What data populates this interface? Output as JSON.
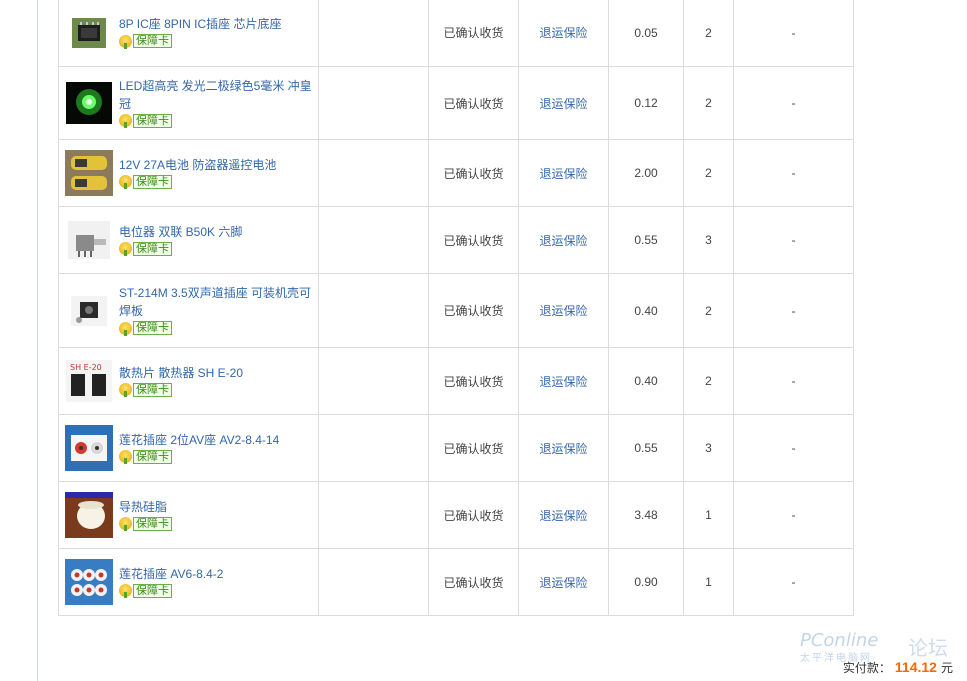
{
  "items": [
    {
      "title": "8P IC座 8PIN IC插座 芯片底座",
      "badge": "保障卡",
      "status": "已确认收货",
      "insurance": "退运保险",
      "price": "0.05",
      "qty": "2",
      "extra": "-",
      "thumb": "ic-socket-thumbnail"
    },
    {
      "title": "LED超高亮 发光二极绿色5毫米 冲皇冠",
      "badge": "保障卡",
      "status": "已确认收货",
      "insurance": "退运保险",
      "price": "0.12",
      "qty": "2",
      "extra": "-",
      "thumb": "green-led-thumbnail"
    },
    {
      "title": "12V 27A电池 防盗器遥控电池",
      "badge": "保障卡",
      "status": "已确认收货",
      "insurance": "退运保险",
      "price": "2.00",
      "qty": "2",
      "extra": "-",
      "thumb": "battery-thumbnail"
    },
    {
      "title": "电位器 双联 B50K 六脚",
      "badge": "保障卡",
      "status": "已确认收货",
      "insurance": "退运保险",
      "price": "0.55",
      "qty": "3",
      "extra": "-",
      "thumb": "potentiometer-thumbnail"
    },
    {
      "title": "ST-214M 3.5双声道插座 可装机壳可焊板",
      "badge": "保障卡",
      "status": "已确认收货",
      "insurance": "退运保险",
      "price": "0.40",
      "qty": "2",
      "extra": "-",
      "thumb": "audio-jack-thumbnail"
    },
    {
      "title": "散热片 散热器 SH E-20",
      "badge": "保障卡",
      "status": "已确认收货",
      "insurance": "退运保险",
      "price": "0.40",
      "qty": "2",
      "extra": "-",
      "thumb": "heatsink-thumbnail"
    },
    {
      "title": "莲花插座 2位AV座 AV2-8.4-14",
      "badge": "保障卡",
      "status": "已确认收货",
      "insurance": "退运保险",
      "price": "0.55",
      "qty": "3",
      "extra": "-",
      "thumb": "av-socket-2-thumbnail"
    },
    {
      "title": "导热硅脂",
      "badge": "保障卡",
      "status": "已确认收货",
      "insurance": "退运保险",
      "price": "3.48",
      "qty": "1",
      "extra": "-",
      "thumb": "thermal-paste-thumbnail"
    },
    {
      "title": "莲花插座 AV6-8.4-2",
      "badge": "保障卡",
      "status": "已确认收货",
      "insurance": "退运保险",
      "price": "0.90",
      "qty": "1",
      "extra": "-",
      "thumb": "av-socket-6-thumbnail"
    }
  ],
  "total": {
    "label": "实付款：",
    "amount": "114.12",
    "unit": "元"
  },
  "watermark": {
    "logo": "PConline",
    "sub": "太平洋电脑网",
    "forum": "论坛"
  },
  "colors": {
    "link": "#3366aa",
    "total_amount": "#ff6600",
    "border": "#dcdcdc"
  }
}
